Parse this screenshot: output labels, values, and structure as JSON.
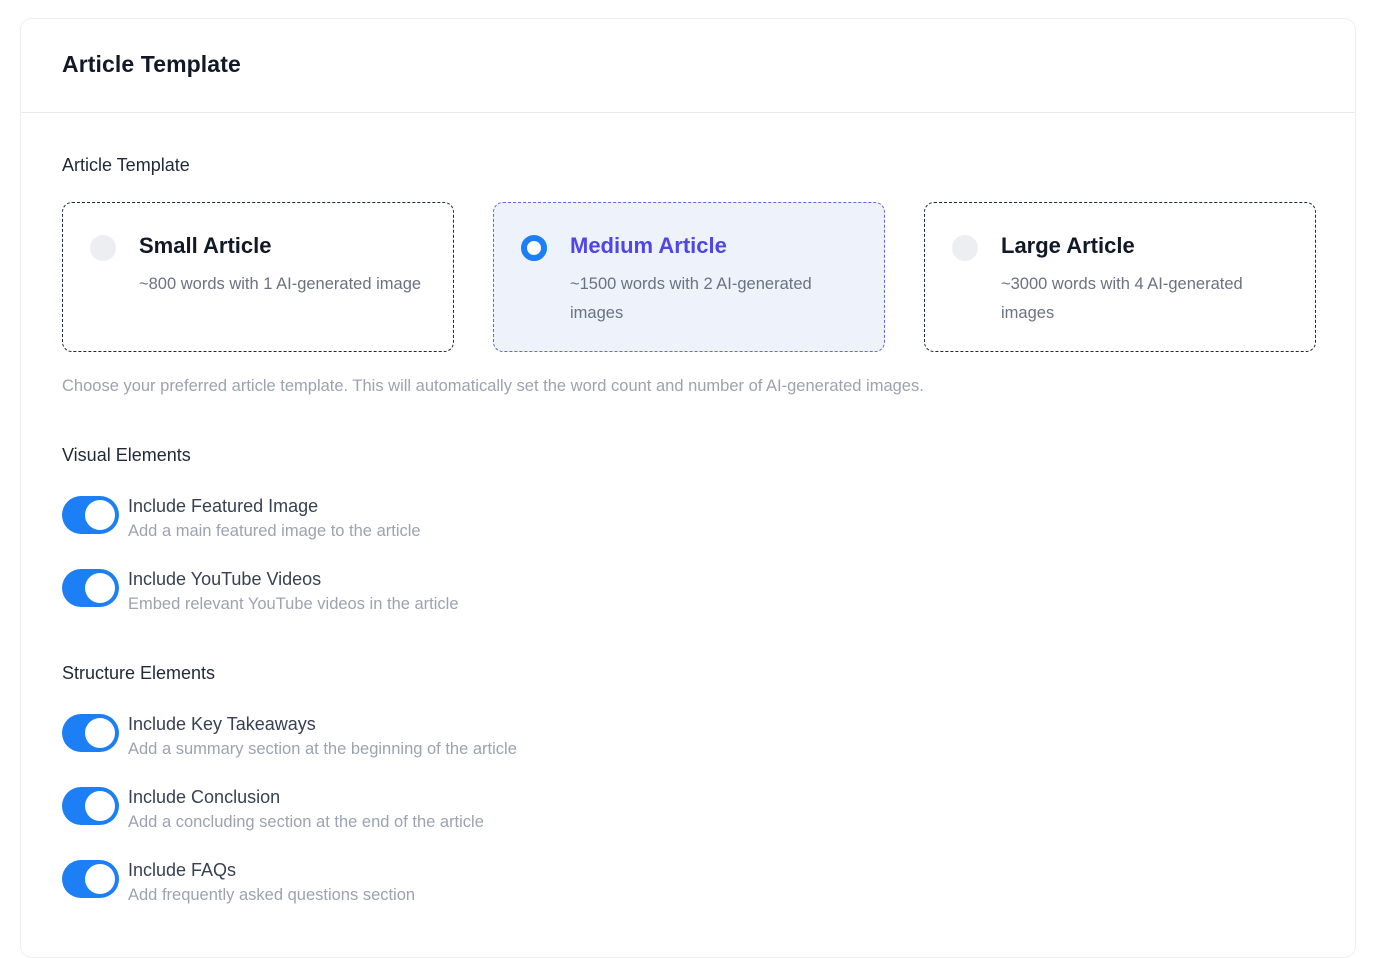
{
  "header": {
    "title": "Article Template"
  },
  "template_section": {
    "label": "Article Template",
    "options": [
      {
        "name": "Small Article",
        "desc": "~800 words with 1 AI-generated image",
        "selected": false
      },
      {
        "name": "Medium Article",
        "desc": "~1500 words with 2 AI-generated images",
        "selected": true
      },
      {
        "name": "Large Article",
        "desc": "~3000 words with 4 AI-generated images",
        "selected": false
      }
    ],
    "help": "Choose your preferred article template. This will automatically set the word count and number of AI-generated images."
  },
  "visual_section": {
    "label": "Visual Elements",
    "items": [
      {
        "title": "Include Featured Image",
        "desc": "Add a main featured image to the article",
        "on": true
      },
      {
        "title": "Include YouTube Videos",
        "desc": "Embed relevant YouTube videos in the article",
        "on": true
      }
    ]
  },
  "structure_section": {
    "label": "Structure Elements",
    "items": [
      {
        "title": "Include Key Takeaways",
        "desc": "Add a summary section at the beginning of the article",
        "on": true
      },
      {
        "title": "Include Conclusion",
        "desc": "Add a concluding section at the end of the article",
        "on": true
      },
      {
        "title": "Include FAQs",
        "desc": "Add frequently asked questions section",
        "on": true
      }
    ]
  },
  "colors": {
    "accent": "#1d7ff5",
    "selected_text": "#4f46e5",
    "selected_bg": "#eef2fb"
  }
}
